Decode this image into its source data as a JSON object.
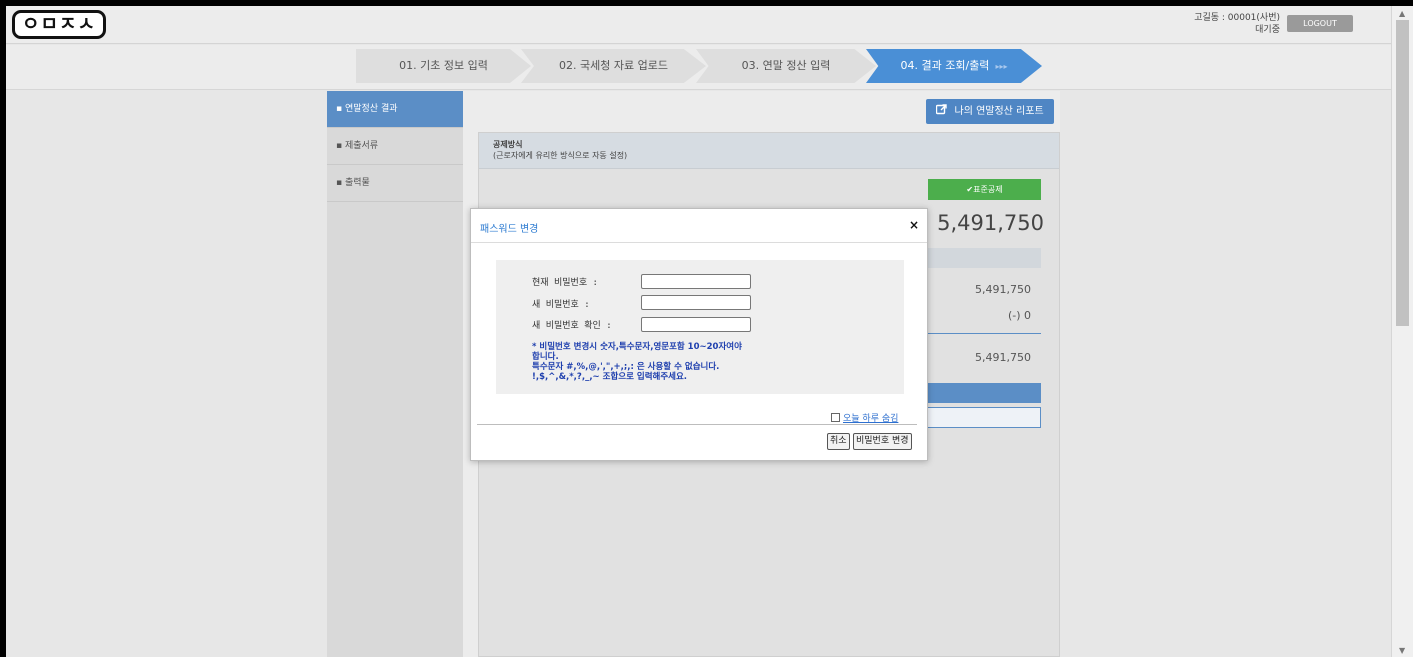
{
  "header": {
    "logo_text": "ㅇㅁㅈㅅ",
    "user_line": "고길동 : 00001(사번)",
    "user_status": "대기중",
    "logout_label": "LOGOUT"
  },
  "steps": [
    {
      "label": "01. 기초 정보 입력"
    },
    {
      "label": "02. 국세청 자료 업로드"
    },
    {
      "label": "03. 연말 정산 입력"
    },
    {
      "label": "04. 결과 조회/출력",
      "arrows": "▸▸▸"
    }
  ],
  "sidebar": {
    "items": [
      {
        "label": "▪ 연말정산 결과"
      },
      {
        "label": "▪ 제출서류"
      },
      {
        "label": "▪ 출력물"
      }
    ]
  },
  "main": {
    "report_button": "나의 연말정산 리포트",
    "deduction_title": "공제방식",
    "deduction_desc": "(근로자에게 유리한 방식으로 자동 설정)",
    "std_button": "✔표준공제",
    "big_amount": "5,491,750",
    "row1": "5,491,750",
    "row2": "(-) 0",
    "row3": "5,491,750"
  },
  "modal": {
    "title": "패스워드 변경",
    "close": "×",
    "label_current": "현재 비밀번호 :",
    "label_new": "새 비밀번호   :",
    "label_confirm": "새 비밀번호 확인 :",
    "notice_1": "* 비밀번호 변경시 숫자,특수문자,영문포함 10~20자여야",
    "notice_2": "합니다.",
    "notice_3": "특수문자 #,%,@,',\",+,;,: 은 사용할 수 없습니다.",
    "notice_4": "!,$,^,&,*,?,_,~ 조합으로 입력해주세요.",
    "hide_today": "오늘 하루 숨김",
    "cancel_button": "취소",
    "change_button": "비밀번호 변경"
  },
  "colors": {
    "accent": "#4a8fd6",
    "green": "#4cae4c",
    "notice": "#1e3fae"
  }
}
